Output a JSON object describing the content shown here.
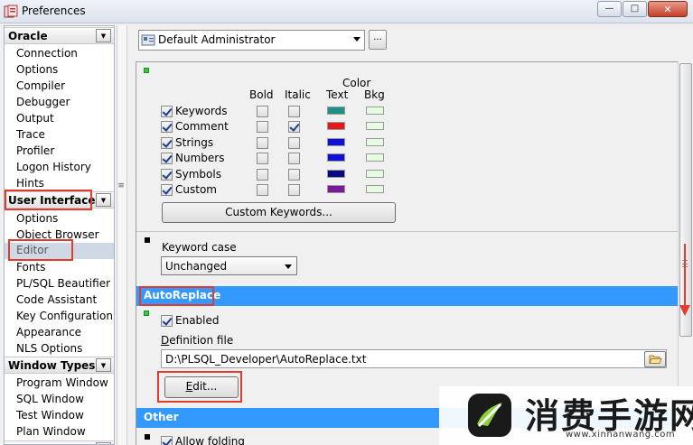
{
  "window": {
    "title": "Preferences",
    "minimize_glyph": "—",
    "maximize_glyph": "□",
    "close_glyph": "✕"
  },
  "tree": {
    "groups": [
      {
        "label": "Oracle",
        "items": [
          "Connection",
          "Options",
          "Compiler",
          "Debugger",
          "Output",
          "Trace",
          "Profiler",
          "Logon History",
          "Hints"
        ]
      },
      {
        "label": "User Interface",
        "items": [
          "Options",
          "Object Browser",
          "Editor",
          "Fonts",
          "PL/SQL Beautifier",
          "Code Assistant",
          "Key Configuration",
          "Appearance",
          "NLS Options"
        ]
      },
      {
        "label": "Window Types",
        "items": [
          "Program Window",
          "SQL Window",
          "Test Window",
          "Plan Window"
        ]
      }
    ],
    "selected_item": "Editor",
    "dropdown_glyph": "▼"
  },
  "profile": {
    "value": "Default Administrator",
    "more_label": "..."
  },
  "syntax_highlighting": {
    "col_bold": "Bold",
    "col_italic": "Italic",
    "col_color": "Color",
    "col_text": "Text",
    "col_bkg": "Bkg",
    "rows": [
      {
        "label": "Keywords",
        "enabled": true,
        "bold": false,
        "italic": false,
        "text_color": "#1f8f88",
        "bkg_color": "#e7fbe2"
      },
      {
        "label": "Comment",
        "enabled": true,
        "bold": false,
        "italic": true,
        "text_color": "#e21a1a",
        "bkg_color": "#e7fbe2"
      },
      {
        "label": "Strings",
        "enabled": true,
        "bold": false,
        "italic": false,
        "text_color": "#1010d6",
        "bkg_color": "#e7fbe2"
      },
      {
        "label": "Numbers",
        "enabled": true,
        "bold": false,
        "italic": false,
        "text_color": "#1010d6",
        "bkg_color": "#e7fbe2"
      },
      {
        "label": "Symbols",
        "enabled": true,
        "bold": false,
        "italic": false,
        "text_color": "#0a0a80",
        "bkg_color": "#e7fbe2"
      },
      {
        "label": "Custom",
        "enabled": true,
        "bold": false,
        "italic": false,
        "text_color": "#7a1a9a",
        "bkg_color": "#e7fbe2"
      }
    ],
    "custom_keywords_button": "Custom Keywords..."
  },
  "keyword_case": {
    "label": "Keyword case",
    "value": "Unchanged"
  },
  "autoreplace": {
    "title": "AutoReplace",
    "enabled_label": "Enabled",
    "enabled": true,
    "definition_file_label": "Definition file",
    "definition_file_value": "D:\\PLSQL_Developer\\AutoReplace.txt",
    "edit_button": "Edit..."
  },
  "other": {
    "title": "Other",
    "allow_folding_label": "Allow folding",
    "allow_folding": true
  },
  "colors": {
    "section_bar": "#3399ff",
    "highlight_red": "#e23b2e",
    "marker_green": "#2fcf3a"
  },
  "watermark": {
    "text": "消费手游网",
    "url": "www.xinnanwang.com"
  }
}
